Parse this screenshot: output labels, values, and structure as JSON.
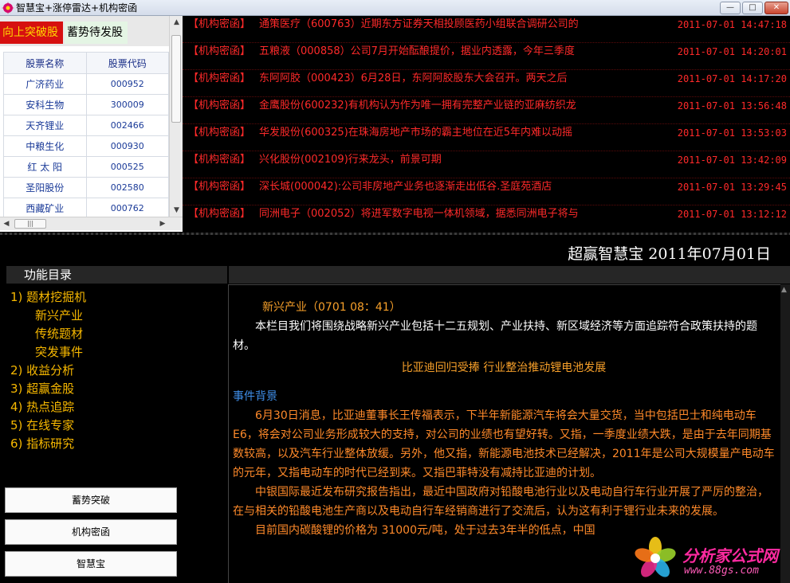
{
  "window": {
    "title": "智慧宝+涨停雷达+机构密函",
    "minimize": "—",
    "maximize": "□",
    "close": "✕"
  },
  "stock_panel": {
    "tabs": [
      {
        "label": "向上突破股",
        "active": true
      },
      {
        "label": "蓄势待发股",
        "active": false
      }
    ],
    "headers": {
      "name": "股票名称",
      "code": "股票代码"
    },
    "rows": [
      {
        "name": "广济药业",
        "code": "000952"
      },
      {
        "name": "安科生物",
        "code": "300009"
      },
      {
        "name": "天齐锂业",
        "code": "002466"
      },
      {
        "name": "中粮生化",
        "code": "000930"
      },
      {
        "name": "红 太 阳",
        "code": "000525"
      },
      {
        "name": "圣阳股份",
        "code": "002580"
      },
      {
        "name": "西藏矿业",
        "code": "000762"
      }
    ]
  },
  "news": [
    {
      "tag": "【机构密函】",
      "headline": "通策医疗（600763）近期东方证券天相投顾医药小组联合调研公司的",
      "time": "2011-07-01 14:47:18"
    },
    {
      "tag": "【机构密函】",
      "headline": "五粮液（000858）公司7月开始酝酿提价，据业内透露，今年三季度",
      "time": "2011-07-01 14:20:01"
    },
    {
      "tag": "【机构密函】",
      "headline": "东阿阿胶（000423）6月28日，东阿阿胶股东大会召开。两天之后",
      "time": "2011-07-01 14:17:20"
    },
    {
      "tag": "【机构密函】",
      "headline": "金鹰股份(600232)有机构认为作为唯一拥有完整产业链的亚麻纺织龙",
      "time": "2011-07-01 13:56:48"
    },
    {
      "tag": "【机构密函】",
      "headline": "华发股份(600325)在珠海房地产市场的霸主地位在近5年内难以动摇",
      "time": "2011-07-01 13:53:03"
    },
    {
      "tag": "【机构密函】",
      "headline": "兴化股份(002109)行来龙头，前景可期",
      "time": "2011-07-01 13:42:09"
    },
    {
      "tag": "【机构密函】",
      "headline": "深长城(000042):公司非房地产业务也逐渐走出低谷.圣庭苑酒店",
      "time": "2011-07-01 13:29:45"
    },
    {
      "tag": "【机构密函】",
      "headline": "同洲电子（002052）将进军数字电视一体机领域，据悉同洲电子将与",
      "time": "2011-07-01 13:12:12"
    }
  ],
  "brand": "超赢智慧宝  2011年07月01日",
  "menu": {
    "header": "功能目录",
    "items": [
      {
        "label": "1) 题材挖掘机",
        "sub": false
      },
      {
        "label": "新兴产业",
        "sub": true
      },
      {
        "label": "传统题材",
        "sub": true
      },
      {
        "label": "突发事件",
        "sub": true
      },
      {
        "label": "2) 收益分析",
        "sub": false
      },
      {
        "label": "3) 超赢金股",
        "sub": false
      },
      {
        "label": "4) 热点追踪",
        "sub": false
      },
      {
        "label": "5) 在线专家",
        "sub": false
      },
      {
        "label": "6) 指标研究",
        "sub": false
      }
    ]
  },
  "buttons": {
    "btn1": "蓄势突破",
    "btn2": "机构密函",
    "btn3": "智慧宝"
  },
  "article": {
    "heading": "新兴产业（0701  08：41）",
    "intro": "本栏目我们将围绕战略新兴产业包括十二五规划、产业扶持、新区域经济等方面追踪符合政策扶持的题材。",
    "title": "比亚迪回归受捧  行业整治推动锂电池发展",
    "section": "事件背景",
    "p1": "6月30日消息，比亚迪董事长王传福表示，下半年新能源汽车将会大量交货，当中包括巴士和纯电动车E6，将会对公司业务形成较大的支持，对公司的业绩也有望好转。又指，一季度业绩大跌，是由于去年同期基数较高，以及汽车行业整体放缓。另外，他又指，新能源电池技术已经解决，2011年是公司大规模量产电动车的元年，又指电动车的时代已经到来。又指巴菲特没有减持比亚迪的计划。",
    "p2": "中银国际最近发布研究报告指出，最近中国政府对铅酸电池行业以及电动自行车行业开展了严厉的整治，在与相关的铅酸电池生产商以及电动自行车经销商进行了交流后，认为这有利于锂行业未来的发展。",
    "p3": "目前国内碳酸锂的价格为  31000元/吨，处于过去3年半的低点，中国"
  },
  "watermark": {
    "name": "分析家公式网",
    "url": "www.88gs.com"
  }
}
